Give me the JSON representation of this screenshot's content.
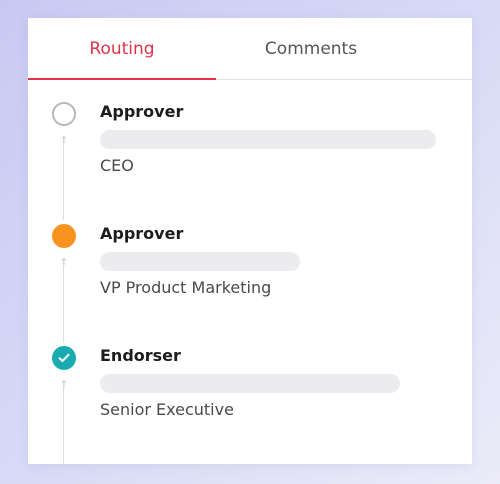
{
  "tabs": {
    "routing_label": "Routing",
    "comments_label": "Comments",
    "active": "Routing"
  },
  "steps": [
    {
      "role": "Approver",
      "title": "CEO",
      "status": "pending"
    },
    {
      "role": "Approver",
      "title": "VP Product Marketing",
      "status": "current"
    },
    {
      "role": "Endorser",
      "title": "Senior Executive",
      "status": "done"
    }
  ],
  "colors": {
    "accent": "#e0334a",
    "pending": "#b7b7bb",
    "current": "#f7941d",
    "done": "#1aabb0"
  }
}
